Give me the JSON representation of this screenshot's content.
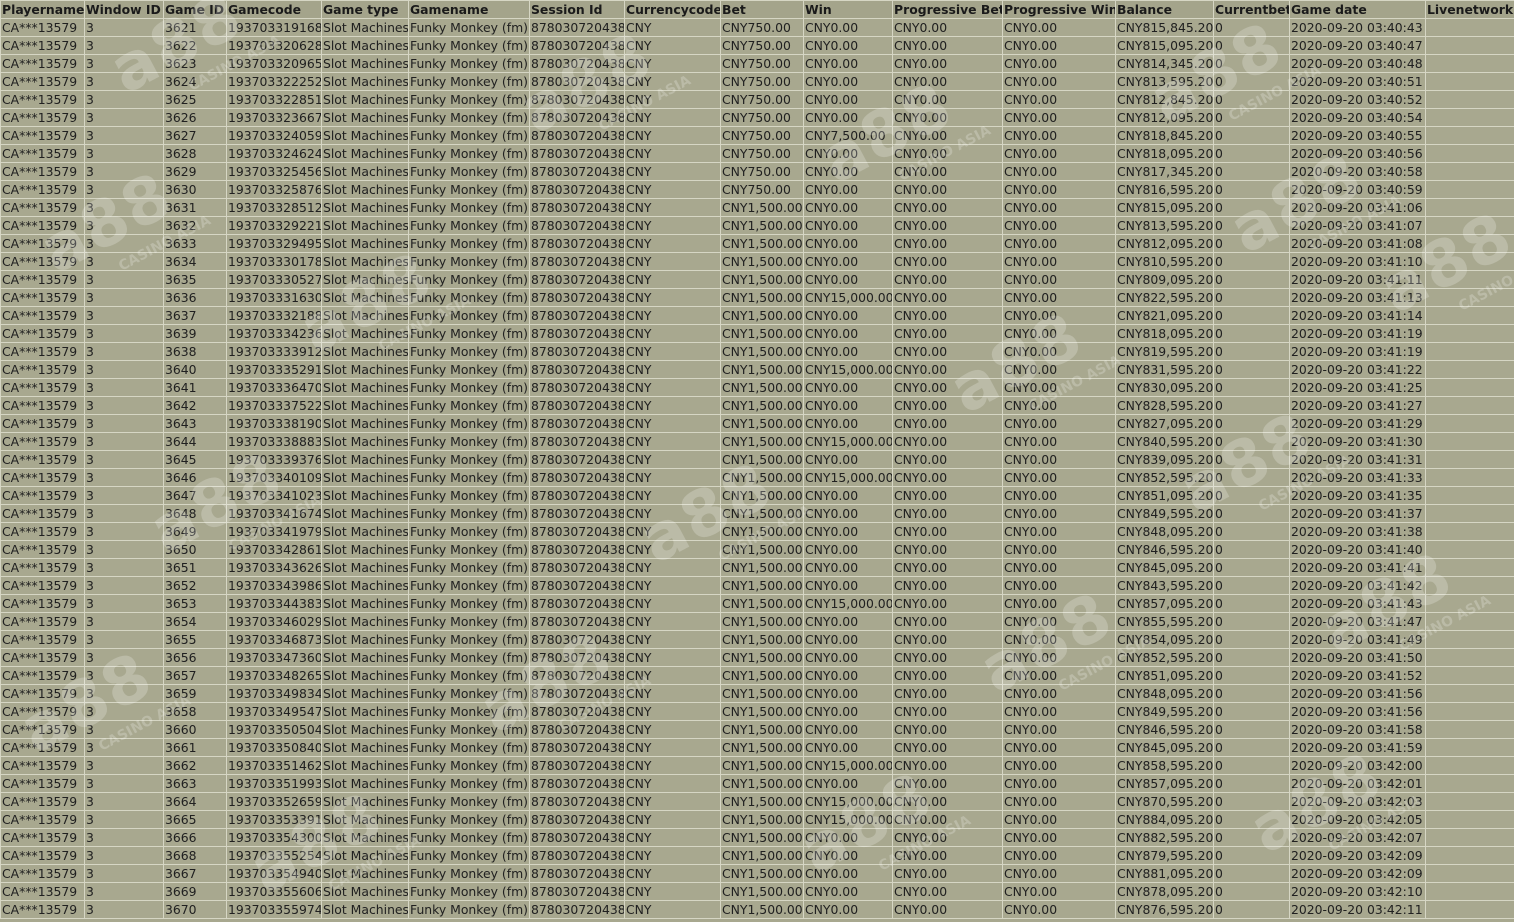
{
  "columns": [
    "Playername",
    "Window ID",
    "Game ID",
    "Gamecode",
    "Game type",
    "Gamename",
    "Session Id",
    "Currencycode",
    "Bet",
    "Win",
    "Progressive Bet",
    "Progressive Win",
    "Balance",
    "Currentbet",
    "Game date",
    "Livenetwork"
  ],
  "colors": {
    "background": "#a8a88f",
    "grid": "#d6d6c4",
    "text": "#202020"
  },
  "watermark": {
    "text": "a88",
    "sub": "CASINO ASIA"
  },
  "rows": [
    [
      "CA***13579",
      "3",
      "3621",
      "193703319168",
      "Slot Machines",
      "Funky Monkey (fm)",
      "878030720438",
      "CNY",
      "CNY750.00",
      "CNY0.00",
      "CNY0.00",
      "CNY0.00",
      "CNY815,845.20",
      "0",
      "2020-09-20 03:40:43",
      ""
    ],
    [
      "CA***13579",
      "3",
      "3622",
      "193703320628",
      "Slot Machines",
      "Funky Monkey (fm)",
      "878030720438",
      "CNY",
      "CNY750.00",
      "CNY0.00",
      "CNY0.00",
      "CNY0.00",
      "CNY815,095.20",
      "0",
      "2020-09-20 03:40:47",
      ""
    ],
    [
      "CA***13579",
      "3",
      "3623",
      "193703320965",
      "Slot Machines",
      "Funky Monkey (fm)",
      "878030720438",
      "CNY",
      "CNY750.00",
      "CNY0.00",
      "CNY0.00",
      "CNY0.00",
      "CNY814,345.20",
      "0",
      "2020-09-20 03:40:48",
      ""
    ],
    [
      "CA***13579",
      "3",
      "3624",
      "193703322252",
      "Slot Machines",
      "Funky Monkey (fm)",
      "878030720438",
      "CNY",
      "CNY750.00",
      "CNY0.00",
      "CNY0.00",
      "CNY0.00",
      "CNY813,595.20",
      "0",
      "2020-09-20 03:40:51",
      ""
    ],
    [
      "CA***13579",
      "3",
      "3625",
      "193703322851",
      "Slot Machines",
      "Funky Monkey (fm)",
      "878030720438",
      "CNY",
      "CNY750.00",
      "CNY0.00",
      "CNY0.00",
      "CNY0.00",
      "CNY812,845.20",
      "0",
      "2020-09-20 03:40:52",
      ""
    ],
    [
      "CA***13579",
      "3",
      "3626",
      "193703323667",
      "Slot Machines",
      "Funky Monkey (fm)",
      "878030720438",
      "CNY",
      "CNY750.00",
      "CNY0.00",
      "CNY0.00",
      "CNY0.00",
      "CNY812,095.20",
      "0",
      "2020-09-20 03:40:54",
      ""
    ],
    [
      "CA***13579",
      "3",
      "3627",
      "193703324059",
      "Slot Machines",
      "Funky Monkey (fm)",
      "878030720438",
      "CNY",
      "CNY750.00",
      "CNY7,500.00",
      "CNY0.00",
      "CNY0.00",
      "CNY818,845.20",
      "0",
      "2020-09-20 03:40:55",
      ""
    ],
    [
      "CA***13579",
      "3",
      "3628",
      "193703324624",
      "Slot Machines",
      "Funky Monkey (fm)",
      "878030720438",
      "CNY",
      "CNY750.00",
      "CNY0.00",
      "CNY0.00",
      "CNY0.00",
      "CNY818,095.20",
      "0",
      "2020-09-20 03:40:56",
      ""
    ],
    [
      "CA***13579",
      "3",
      "3629",
      "193703325456",
      "Slot Machines",
      "Funky Monkey (fm)",
      "878030720438",
      "CNY",
      "CNY750.00",
      "CNY0.00",
      "CNY0.00",
      "CNY0.00",
      "CNY817,345.20",
      "0",
      "2020-09-20 03:40:58",
      ""
    ],
    [
      "CA***13579",
      "3",
      "3630",
      "193703325876",
      "Slot Machines",
      "Funky Monkey (fm)",
      "878030720438",
      "CNY",
      "CNY750.00",
      "CNY0.00",
      "CNY0.00",
      "CNY0.00",
      "CNY816,595.20",
      "0",
      "2020-09-20 03:40:59",
      ""
    ],
    [
      "CA***13579",
      "3",
      "3631",
      "193703328512",
      "Slot Machines",
      "Funky Monkey (fm)",
      "878030720438",
      "CNY",
      "CNY1,500.00",
      "CNY0.00",
      "CNY0.00",
      "CNY0.00",
      "CNY815,095.20",
      "0",
      "2020-09-20 03:41:06",
      ""
    ],
    [
      "CA***13579",
      "3",
      "3632",
      "193703329221",
      "Slot Machines",
      "Funky Monkey (fm)",
      "878030720438",
      "CNY",
      "CNY1,500.00",
      "CNY0.00",
      "CNY0.00",
      "CNY0.00",
      "CNY813,595.20",
      "0",
      "2020-09-20 03:41:07",
      ""
    ],
    [
      "CA***13579",
      "3",
      "3633",
      "193703329495",
      "Slot Machines",
      "Funky Monkey (fm)",
      "878030720438",
      "CNY",
      "CNY1,500.00",
      "CNY0.00",
      "CNY0.00",
      "CNY0.00",
      "CNY812,095.20",
      "0",
      "2020-09-20 03:41:08",
      ""
    ],
    [
      "CA***13579",
      "3",
      "3634",
      "193703330178",
      "Slot Machines",
      "Funky Monkey (fm)",
      "878030720438",
      "CNY",
      "CNY1,500.00",
      "CNY0.00",
      "CNY0.00",
      "CNY0.00",
      "CNY810,595.20",
      "0",
      "2020-09-20 03:41:10",
      ""
    ],
    [
      "CA***13579",
      "3",
      "3635",
      "193703330527",
      "Slot Machines",
      "Funky Monkey (fm)",
      "878030720438",
      "CNY",
      "CNY1,500.00",
      "CNY0.00",
      "CNY0.00",
      "CNY0.00",
      "CNY809,095.20",
      "0",
      "2020-09-20 03:41:11",
      ""
    ],
    [
      "CA***13579",
      "3",
      "3636",
      "193703331630",
      "Slot Machines",
      "Funky Monkey (fm)",
      "878030720438",
      "CNY",
      "CNY1,500.00",
      "CNY15,000.00",
      "CNY0.00",
      "CNY0.00",
      "CNY822,595.20",
      "0",
      "2020-09-20 03:41:13",
      ""
    ],
    [
      "CA***13579",
      "3",
      "3637",
      "193703332188",
      "Slot Machines",
      "Funky Monkey (fm)",
      "878030720438",
      "CNY",
      "CNY1,500.00",
      "CNY0.00",
      "CNY0.00",
      "CNY0.00",
      "CNY821,095.20",
      "0",
      "2020-09-20 03:41:14",
      ""
    ],
    [
      "CA***13579",
      "3",
      "3639",
      "193703334236",
      "Slot Machines",
      "Funky Monkey (fm)",
      "878030720438",
      "CNY",
      "CNY1,500.00",
      "CNY0.00",
      "CNY0.00",
      "CNY0.00",
      "CNY818,095.20",
      "0",
      "2020-09-20 03:41:19",
      ""
    ],
    [
      "CA***13579",
      "3",
      "3638",
      "193703333912",
      "Slot Machines",
      "Funky Monkey (fm)",
      "878030720438",
      "CNY",
      "CNY1,500.00",
      "CNY0.00",
      "CNY0.00",
      "CNY0.00",
      "CNY819,595.20",
      "0",
      "2020-09-20 03:41:19",
      ""
    ],
    [
      "CA***13579",
      "3",
      "3640",
      "193703335291",
      "Slot Machines",
      "Funky Monkey (fm)",
      "878030720438",
      "CNY",
      "CNY1,500.00",
      "CNY15,000.00",
      "CNY0.00",
      "CNY0.00",
      "CNY831,595.20",
      "0",
      "2020-09-20 03:41:22",
      ""
    ],
    [
      "CA***13579",
      "3",
      "3641",
      "193703336470",
      "Slot Machines",
      "Funky Monkey (fm)",
      "878030720438",
      "CNY",
      "CNY1,500.00",
      "CNY0.00",
      "CNY0.00",
      "CNY0.00",
      "CNY830,095.20",
      "0",
      "2020-09-20 03:41:25",
      ""
    ],
    [
      "CA***13579",
      "3",
      "3642",
      "193703337522",
      "Slot Machines",
      "Funky Monkey (fm)",
      "878030720438",
      "CNY",
      "CNY1,500.00",
      "CNY0.00",
      "CNY0.00",
      "CNY0.00",
      "CNY828,595.20",
      "0",
      "2020-09-20 03:41:27",
      ""
    ],
    [
      "CA***13579",
      "3",
      "3643",
      "193703338190",
      "Slot Machines",
      "Funky Monkey (fm)",
      "878030720438",
      "CNY",
      "CNY1,500.00",
      "CNY0.00",
      "CNY0.00",
      "CNY0.00",
      "CNY827,095.20",
      "0",
      "2020-09-20 03:41:29",
      ""
    ],
    [
      "CA***13579",
      "3",
      "3644",
      "193703338883",
      "Slot Machines",
      "Funky Monkey (fm)",
      "878030720438",
      "CNY",
      "CNY1,500.00",
      "CNY15,000.00",
      "CNY0.00",
      "CNY0.00",
      "CNY840,595.20",
      "0",
      "2020-09-20 03:41:30",
      ""
    ],
    [
      "CA***13579",
      "3",
      "3645",
      "193703339376",
      "Slot Machines",
      "Funky Monkey (fm)",
      "878030720438",
      "CNY",
      "CNY1,500.00",
      "CNY0.00",
      "CNY0.00",
      "CNY0.00",
      "CNY839,095.20",
      "0",
      "2020-09-20 03:41:31",
      ""
    ],
    [
      "CA***13579",
      "3",
      "3646",
      "193703340109",
      "Slot Machines",
      "Funky Monkey (fm)",
      "878030720438",
      "CNY",
      "CNY1,500.00",
      "CNY15,000.00",
      "CNY0.00",
      "CNY0.00",
      "CNY852,595.20",
      "0",
      "2020-09-20 03:41:33",
      ""
    ],
    [
      "CA***13579",
      "3",
      "3647",
      "193703341023",
      "Slot Machines",
      "Funky Monkey (fm)",
      "878030720438",
      "CNY",
      "CNY1,500.00",
      "CNY0.00",
      "CNY0.00",
      "CNY0.00",
      "CNY851,095.20",
      "0",
      "2020-09-20 03:41:35",
      ""
    ],
    [
      "CA***13579",
      "3",
      "3648",
      "193703341674",
      "Slot Machines",
      "Funky Monkey (fm)",
      "878030720438",
      "CNY",
      "CNY1,500.00",
      "CNY0.00",
      "CNY0.00",
      "CNY0.00",
      "CNY849,595.20",
      "0",
      "2020-09-20 03:41:37",
      ""
    ],
    [
      "CA***13579",
      "3",
      "3649",
      "193703341979",
      "Slot Machines",
      "Funky Monkey (fm)",
      "878030720438",
      "CNY",
      "CNY1,500.00",
      "CNY0.00",
      "CNY0.00",
      "CNY0.00",
      "CNY848,095.20",
      "0",
      "2020-09-20 03:41:38",
      ""
    ],
    [
      "CA***13579",
      "3",
      "3650",
      "193703342861",
      "Slot Machines",
      "Funky Monkey (fm)",
      "878030720438",
      "CNY",
      "CNY1,500.00",
      "CNY0.00",
      "CNY0.00",
      "CNY0.00",
      "CNY846,595.20",
      "0",
      "2020-09-20 03:41:40",
      ""
    ],
    [
      "CA***13579",
      "3",
      "3651",
      "193703343626",
      "Slot Machines",
      "Funky Monkey (fm)",
      "878030720438",
      "CNY",
      "CNY1,500.00",
      "CNY0.00",
      "CNY0.00",
      "CNY0.00",
      "CNY845,095.20",
      "0",
      "2020-09-20 03:41:41",
      ""
    ],
    [
      "CA***13579",
      "3",
      "3652",
      "193703343986",
      "Slot Machines",
      "Funky Monkey (fm)",
      "878030720438",
      "CNY",
      "CNY1,500.00",
      "CNY0.00",
      "CNY0.00",
      "CNY0.00",
      "CNY843,595.20",
      "0",
      "2020-09-20 03:41:42",
      ""
    ],
    [
      "CA***13579",
      "3",
      "3653",
      "193703344383",
      "Slot Machines",
      "Funky Monkey (fm)",
      "878030720438",
      "CNY",
      "CNY1,500.00",
      "CNY15,000.00",
      "CNY0.00",
      "CNY0.00",
      "CNY857,095.20",
      "0",
      "2020-09-20 03:41:43",
      ""
    ],
    [
      "CA***13579",
      "3",
      "3654",
      "193703346029",
      "Slot Machines",
      "Funky Monkey (fm)",
      "878030720438",
      "CNY",
      "CNY1,500.00",
      "CNY0.00",
      "CNY0.00",
      "CNY0.00",
      "CNY855,595.20",
      "0",
      "2020-09-20 03:41:47",
      ""
    ],
    [
      "CA***13579",
      "3",
      "3655",
      "193703346873",
      "Slot Machines",
      "Funky Monkey (fm)",
      "878030720438",
      "CNY",
      "CNY1,500.00",
      "CNY0.00",
      "CNY0.00",
      "CNY0.00",
      "CNY854,095.20",
      "0",
      "2020-09-20 03:41:49",
      ""
    ],
    [
      "CA***13579",
      "3",
      "3656",
      "193703347360",
      "Slot Machines",
      "Funky Monkey (fm)",
      "878030720438",
      "CNY",
      "CNY1,500.00",
      "CNY0.00",
      "CNY0.00",
      "CNY0.00",
      "CNY852,595.20",
      "0",
      "2020-09-20 03:41:50",
      ""
    ],
    [
      "CA***13579",
      "3",
      "3657",
      "193703348265",
      "Slot Machines",
      "Funky Monkey (fm)",
      "878030720438",
      "CNY",
      "CNY1,500.00",
      "CNY0.00",
      "CNY0.00",
      "CNY0.00",
      "CNY851,095.20",
      "0",
      "2020-09-20 03:41:52",
      ""
    ],
    [
      "CA***13579",
      "3",
      "3659",
      "193703349834",
      "Slot Machines",
      "Funky Monkey (fm)",
      "878030720438",
      "CNY",
      "CNY1,500.00",
      "CNY0.00",
      "CNY0.00",
      "CNY0.00",
      "CNY848,095.20",
      "0",
      "2020-09-20 03:41:56",
      ""
    ],
    [
      "CA***13579",
      "3",
      "3658",
      "193703349547",
      "Slot Machines",
      "Funky Monkey (fm)",
      "878030720438",
      "CNY",
      "CNY1,500.00",
      "CNY0.00",
      "CNY0.00",
      "CNY0.00",
      "CNY849,595.20",
      "0",
      "2020-09-20 03:41:56",
      ""
    ],
    [
      "CA***13579",
      "3",
      "3660",
      "193703350504",
      "Slot Machines",
      "Funky Monkey (fm)",
      "878030720438",
      "CNY",
      "CNY1,500.00",
      "CNY0.00",
      "CNY0.00",
      "CNY0.00",
      "CNY846,595.20",
      "0",
      "2020-09-20 03:41:58",
      ""
    ],
    [
      "CA***13579",
      "3",
      "3661",
      "193703350840",
      "Slot Machines",
      "Funky Monkey (fm)",
      "878030720438",
      "CNY",
      "CNY1,500.00",
      "CNY0.00",
      "CNY0.00",
      "CNY0.00",
      "CNY845,095.20",
      "0",
      "2020-09-20 03:41:59",
      ""
    ],
    [
      "CA***13579",
      "3",
      "3662",
      "193703351462",
      "Slot Machines",
      "Funky Monkey (fm)",
      "878030720438",
      "CNY",
      "CNY1,500.00",
      "CNY15,000.00",
      "CNY0.00",
      "CNY0.00",
      "CNY858,595.20",
      "0",
      "2020-09-20 03:42:00",
      ""
    ],
    [
      "CA***13579",
      "3",
      "3663",
      "193703351993",
      "Slot Machines",
      "Funky Monkey (fm)",
      "878030720438",
      "CNY",
      "CNY1,500.00",
      "CNY0.00",
      "CNY0.00",
      "CNY0.00",
      "CNY857,095.20",
      "0",
      "2020-09-20 03:42:01",
      ""
    ],
    [
      "CA***13579",
      "3",
      "3664",
      "193703352659",
      "Slot Machines",
      "Funky Monkey (fm)",
      "878030720438",
      "CNY",
      "CNY1,500.00",
      "CNY15,000.00",
      "CNY0.00",
      "CNY0.00",
      "CNY870,595.20",
      "0",
      "2020-09-20 03:42:03",
      ""
    ],
    [
      "CA***13579",
      "3",
      "3665",
      "193703353391",
      "Slot Machines",
      "Funky Monkey (fm)",
      "878030720438",
      "CNY",
      "CNY1,500.00",
      "CNY15,000.00",
      "CNY0.00",
      "CNY0.00",
      "CNY884,095.20",
      "0",
      "2020-09-20 03:42:05",
      ""
    ],
    [
      "CA***13579",
      "3",
      "3666",
      "193703354300",
      "Slot Machines",
      "Funky Monkey (fm)",
      "878030720438",
      "CNY",
      "CNY1,500.00",
      "CNY0.00",
      "CNY0.00",
      "CNY0.00",
      "CNY882,595.20",
      "0",
      "2020-09-20 03:42:07",
      ""
    ],
    [
      "CA***13579",
      "3",
      "3668",
      "193703355254",
      "Slot Machines",
      "Funky Monkey (fm)",
      "878030720438",
      "CNY",
      "CNY1,500.00",
      "CNY0.00",
      "CNY0.00",
      "CNY0.00",
      "CNY879,595.20",
      "0",
      "2020-09-20 03:42:09",
      ""
    ],
    [
      "CA***13579",
      "3",
      "3667",
      "193703354940",
      "Slot Machines",
      "Funky Monkey (fm)",
      "878030720438",
      "CNY",
      "CNY1,500.00",
      "CNY0.00",
      "CNY0.00",
      "CNY0.00",
      "CNY881,095.20",
      "0",
      "2020-09-20 03:42:09",
      ""
    ],
    [
      "CA***13579",
      "3",
      "3669",
      "193703355606",
      "Slot Machines",
      "Funky Monkey (fm)",
      "878030720438",
      "CNY",
      "CNY1,500.00",
      "CNY0.00",
      "CNY0.00",
      "CNY0.00",
      "CNY878,095.20",
      "0",
      "2020-09-20 03:42:10",
      ""
    ],
    [
      "CA***13579",
      "3",
      "3670",
      "193703355974",
      "Slot Machines",
      "Funky Monkey (fm)",
      "878030720438",
      "CNY",
      "CNY1,500.00",
      "CNY0.00",
      "CNY0.00",
      "CNY0.00",
      "CNY876,595.20",
      "0",
      "2020-09-20 03:42:11",
      ""
    ]
  ]
}
